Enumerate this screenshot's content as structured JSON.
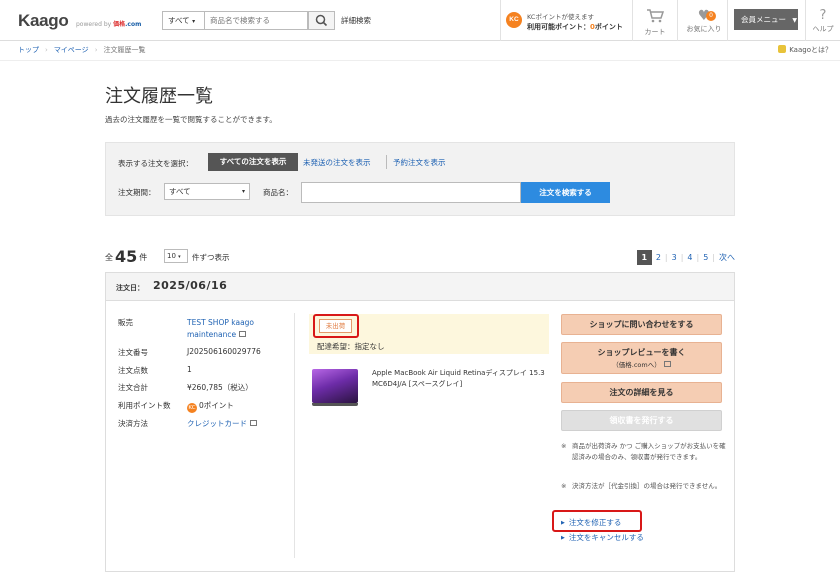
{
  "header": {
    "logo": "Kaago",
    "logo_sub_prefix": "powered by",
    "logo_sub_brand": "価格",
    "logo_sub_suffix": ".com",
    "category_select": "すべて",
    "search_placeholder": "商品名で検索する",
    "advanced_search": "詳細検索",
    "kc_badge": "KC",
    "kc_line1": "KCポイントが使えます",
    "kc_label": "利用可能ポイント：",
    "kc_points": "0",
    "kc_unit": "ポイント",
    "cart_label": "カート",
    "fav_label": "お気に入り",
    "fav_count": "0",
    "member_menu": "会員メニュー",
    "help_label": "ヘルプ"
  },
  "breadcrumb": {
    "items": [
      "トップ",
      "マイページ",
      "注文履歴一覧"
    ],
    "about": "Kaagoとは？"
  },
  "page": {
    "title": "注文履歴一覧",
    "description": "過去の注文履歴を一覧で閲覧することができます。"
  },
  "filter": {
    "select_label": "表示する注文を選択：",
    "tab_all": "すべての注文を表示",
    "tab_unshipped": "未発送の注文を表示",
    "tab_reserved": "予約注文を表示",
    "period_label": "注文期間：",
    "period_value": "すべて",
    "product_label": "商品名：",
    "product_value": "",
    "search_button": "注文を検索する"
  },
  "listing": {
    "count_prefix": "全",
    "count": "45",
    "count_suffix": "件",
    "per_page": "10",
    "per_page_suffix": "件ずつ表示",
    "pages": [
      "1",
      "2",
      "3",
      "4",
      "5"
    ],
    "current_page": "1",
    "next": "次へ"
  },
  "order": {
    "date_label": "注文日：",
    "date": "2025/06/16",
    "details": [
      {
        "label": "販売",
        "value": "TEST SHOP kaago maintenance",
        "link": true
      },
      {
        "label": "注文番号",
        "value": "J202506160029776"
      },
      {
        "label": "注文点数",
        "value": "1"
      },
      {
        "label": "注文合計",
        "value": "¥260,785（税込）"
      },
      {
        "label": "利用ポイント数",
        "value": "0ポイント"
      },
      {
        "label": "決済方法",
        "value": "クレジットカード",
        "link": true
      }
    ],
    "points_badge": "KC",
    "status_badge": "未出荷",
    "shipping_note": "配達希望：指定なし",
    "product_name": "Apple MacBook Air Liquid Retinaディスプレイ 15.3 MC6D4J/A [スペースグレイ]",
    "actions": {
      "contact_shop": "ショップに問い合わせをする",
      "write_review": "ショップレビューを書く",
      "review_sub": "（価格.comへ）",
      "order_details": "注文の詳細を見る",
      "issue_receipt": "領収書を発行する"
    },
    "notes": [
      "商品が出荷済み かつ ご購入ショップがお支払いを確認済みの場合のみ、領収書が発行できます。",
      "決済方法が［代金引換］の場合は発行できません。"
    ],
    "note_mark": "※",
    "links": {
      "modify": "注文を修正する",
      "cancel": "注文をキャンセルする"
    }
  }
}
